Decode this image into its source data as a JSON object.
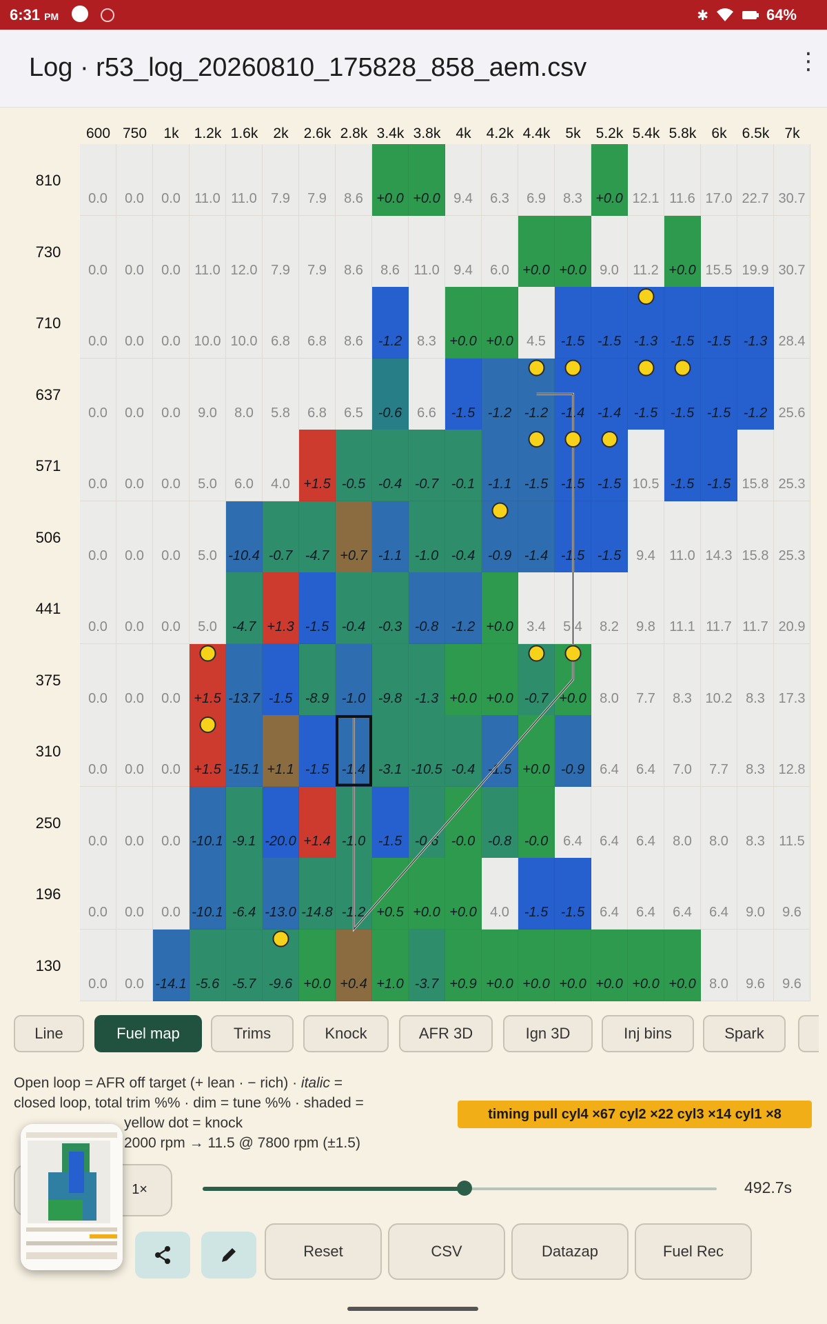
{
  "status_bar": {
    "time": "6:31",
    "ampm": "PM",
    "battery": "64%"
  },
  "app_bar": {
    "title": "Log · r53_log_20260810_175828_858_aem.csv",
    "menu_icon": "more-vert-icon"
  },
  "fuel_map": {
    "columns": [
      "600",
      "750",
      "1k",
      "1.2k",
      "1.6k",
      "2k",
      "2.6k",
      "2.8k",
      "3.4k",
      "3.8k",
      "4k",
      "4.2k",
      "4.4k",
      "5k",
      "5.2k",
      "5.4k",
      "5.8k",
      "6k",
      "6.5k",
      "7k"
    ],
    "rows": [
      "810",
      "730",
      "710",
      "637",
      "571",
      "506",
      "441",
      "375",
      "310",
      "250",
      "196",
      "130"
    ],
    "cells": [
      [
        "0.0",
        "0.0",
        "0.0",
        "11.0",
        "11.0",
        "7.9",
        "7.9",
        "8.6",
        "+0.0",
        "+0.0",
        "9.4",
        "6.3",
        "6.9",
        "8.3",
        "+0.0",
        "12.1",
        "11.6",
        "17.0",
        "22.7",
        "30.7"
      ],
      [
        "0.0",
        "0.0",
        "0.0",
        "11.0",
        "12.0",
        "7.9",
        "7.9",
        "8.6",
        "8.6",
        "11.0",
        "9.4",
        "6.0",
        "+0.0",
        "+0.0",
        "9.0",
        "11.2",
        "+0.0",
        "15.5",
        "19.9",
        "30.7"
      ],
      [
        "0.0",
        "0.0",
        "0.0",
        "10.0",
        "10.0",
        "6.8",
        "6.8",
        "8.6",
        "-1.2",
        "8.3",
        "+0.0",
        "+0.0",
        "4.5",
        "-1.5",
        "-1.5",
        "-1.3",
        "-1.5",
        "-1.5",
        "-1.3",
        "28.4"
      ],
      [
        "0.0",
        "0.0",
        "0.0",
        "9.0",
        "8.0",
        "5.8",
        "6.8",
        "6.5",
        "-0.6",
        "6.6",
        "-1.5",
        "-1.2",
        "-1.2",
        "-1.4",
        "-1.4",
        "-1.5",
        "-1.5",
        "-1.5",
        "-1.2",
        "25.6"
      ],
      [
        "0.0",
        "0.0",
        "0.0",
        "5.0",
        "6.0",
        "4.0",
        "+1.5",
        "-0.5",
        "-0.4",
        "-0.7",
        "-0.1",
        "-1.1",
        "-1.5",
        "-1.5",
        "-1.5",
        "10.5",
        "-1.5",
        "-1.5",
        "15.8",
        "25.3"
      ],
      [
        "0.0",
        "0.0",
        "0.0",
        "5.0",
        "-10.4",
        "-0.7",
        "-4.7",
        "+0.7",
        "-1.1",
        "-1.0",
        "-0.4",
        "-0.9",
        "-1.4",
        "-1.5",
        "-1.5",
        "9.4",
        "11.0",
        "14.3",
        "15.8",
        "25.3"
      ],
      [
        "0.0",
        "0.0",
        "0.0",
        "5.0",
        "-4.7",
        "+1.3",
        "-1.5",
        "-0.4",
        "-0.3",
        "-0.8",
        "-1.2",
        "+0.0",
        "3.4",
        "5.4",
        "8.2",
        "9.8",
        "11.1",
        "11.7",
        "11.7",
        "20.9"
      ],
      [
        "0.0",
        "0.0",
        "0.0",
        "+1.5",
        "-13.7",
        "-1.5",
        "-8.9",
        "-1.0",
        "-9.8",
        "-1.3",
        "+0.0",
        "+0.0",
        "-0.7",
        "+0.0",
        "8.0",
        "7.7",
        "8.3",
        "10.2",
        "8.3",
        "17.3"
      ],
      [
        "0.0",
        "0.0",
        "0.0",
        "+1.5",
        "-15.1",
        "+1.1",
        "-1.5",
        "-1.4",
        "-3.1",
        "-10.5",
        "-0.4",
        "-1.5",
        "+0.0",
        "-0.9",
        "6.4",
        "6.4",
        "7.0",
        "7.7",
        "8.3",
        "12.8"
      ],
      [
        "0.0",
        "0.0",
        "0.0",
        "-10.1",
        "-9.1",
        "-20.0",
        "+1.4",
        "-1.0",
        "-1.5",
        "-0.6",
        "-0.0",
        "-0.8",
        "-0.0",
        "6.4",
        "6.4",
        "6.4",
        "8.0",
        "8.0",
        "8.3",
        "11.5"
      ],
      [
        "0.0",
        "0.0",
        "0.0",
        "-10.1",
        "-6.4",
        "-13.0",
        "-14.8",
        "-1.2",
        "+0.5",
        "+0.0",
        "+0.0",
        "4.0",
        "-1.5",
        "-1.5",
        "6.4",
        "6.4",
        "6.4",
        "6.4",
        "9.0",
        "9.6"
      ],
      [
        "0.0",
        "0.0",
        "-14.1",
        "-5.6",
        "-5.7",
        "-9.6",
        "+0.0",
        "+0.4",
        "+1.0",
        "-3.7",
        "+0.9",
        "+0.0",
        "+0.0",
        "+0.0",
        "+0.0",
        "+0.0",
        "+0.0",
        "8.0",
        "9.6",
        "9.6"
      ]
    ],
    "colors": [
      [
        "N",
        "N",
        "N",
        "N",
        "N",
        "N",
        "N",
        "N",
        "G",
        "G",
        "N",
        "N",
        "N",
        "N",
        "G",
        "N",
        "N",
        "N",
        "N",
        "N"
      ],
      [
        "N",
        "N",
        "N",
        "N",
        "N",
        "N",
        "N",
        "N",
        "N",
        "N",
        "N",
        "N",
        "G",
        "G",
        "N",
        "N",
        "G",
        "N",
        "N",
        "N"
      ],
      [
        "N",
        "N",
        "N",
        "N",
        "N",
        "N",
        "N",
        "N",
        "B",
        "N",
        "G",
        "G",
        "N",
        "B",
        "B",
        "B",
        "B",
        "B",
        "B",
        "N"
      ],
      [
        "N",
        "N",
        "N",
        "N",
        "N",
        "N",
        "N",
        "N",
        "T",
        "N",
        "B",
        "b",
        "b",
        "B",
        "B",
        "B",
        "B",
        "B",
        "B",
        "N"
      ],
      [
        "N",
        "N",
        "N",
        "N",
        "N",
        "N",
        "R",
        "t",
        "t",
        "t",
        "t",
        "b",
        "b",
        "B",
        "B",
        "N",
        "B",
        "B",
        "N",
        "N"
      ],
      [
        "N",
        "N",
        "N",
        "N",
        "b",
        "t",
        "t",
        "O",
        "b",
        "t",
        "t",
        "b",
        "b",
        "B",
        "B",
        "N",
        "N",
        "N",
        "N",
        "N"
      ],
      [
        "N",
        "N",
        "N",
        "N",
        "t",
        "R",
        "B",
        "t",
        "t",
        "b",
        "b",
        "G",
        "N",
        "N",
        "N",
        "N",
        "N",
        "N",
        "N",
        "N"
      ],
      [
        "N",
        "N",
        "N",
        "R",
        "b",
        "B",
        "t",
        "b",
        "t",
        "t",
        "G",
        "G",
        "t",
        "G",
        "N",
        "N",
        "N",
        "N",
        "N",
        "N"
      ],
      [
        "N",
        "N",
        "N",
        "R",
        "b",
        "O",
        "B",
        "b",
        "t",
        "t",
        "t",
        "b",
        "G",
        "b",
        "N",
        "N",
        "N",
        "N",
        "N",
        "N"
      ],
      [
        "N",
        "N",
        "N",
        "b",
        "t",
        "B",
        "R",
        "t",
        "B",
        "t",
        "G",
        "t",
        "G",
        "N",
        "N",
        "N",
        "N",
        "N",
        "N",
        "N"
      ],
      [
        "N",
        "N",
        "N",
        "b",
        "t",
        "b",
        "t",
        "t",
        "G",
        "G",
        "G",
        "N",
        "B",
        "B",
        "N",
        "N",
        "N",
        "N",
        "N",
        "N"
      ],
      [
        "N",
        "N",
        "b",
        "t",
        "t",
        "t",
        "G",
        "O",
        "G",
        "t",
        "G",
        "G",
        "G",
        "G",
        "G",
        "G",
        "G",
        "N",
        "N",
        "N"
      ]
    ],
    "knock_dots": [
      [
        2,
        15
      ],
      [
        3,
        12
      ],
      [
        3,
        13
      ],
      [
        3,
        15
      ],
      [
        3,
        16
      ],
      [
        4,
        12
      ],
      [
        4,
        13
      ],
      [
        4,
        14
      ],
      [
        5,
        11
      ],
      [
        7,
        3
      ],
      [
        7,
        12
      ],
      [
        7,
        13
      ],
      [
        8,
        3
      ],
      [
        11,
        5
      ]
    ],
    "trace_path": [
      [
        3,
        12.5
      ],
      [
        3,
        13.5
      ],
      [
        7,
        13.5
      ],
      [
        10.5,
        7.5
      ],
      [
        7.5,
        7.5
      ]
    ],
    "current_cell": [
      8,
      7
    ]
  },
  "tabs": [
    "Line",
    "Fuel map",
    "Trims",
    "Knock",
    "AFR 3D",
    "Ign 3D",
    "Inj bins",
    "Spark"
  ],
  "active_tab": "Fuel map",
  "legend": {
    "line1": "Open loop = AFR off target (+ lean · − rich) · ",
    "line1_italic": "italic",
    "line1_end": " =",
    "line2": "closed loop, total trim %% · dim = tune %% · shaded =",
    "line3": "yellow dot = knock",
    "line4": "2000 rpm → 11.5 @ 7800 rpm (±1.5)"
  },
  "timing_badge": "timing pull cyl4 ×67  cyl2 ×22  cyl3 ×14  cyl1 ×8",
  "playback": {
    "speed": "1×",
    "time": "492.7s",
    "progress": 0.51
  },
  "actions": {
    "reset": "Reset",
    "csv": "CSV",
    "datazap": "Datazap",
    "fuel_rec": "Fuel Rec"
  },
  "palette": {
    "N": "#ebebea",
    "G": "#2e9a4e",
    "B": "#2660cf",
    "b": "#2d6db0",
    "T": "#277e86",
    "t": "#2e8e6b",
    "R": "#cc3b2e",
    "O": "#8b6b40"
  }
}
